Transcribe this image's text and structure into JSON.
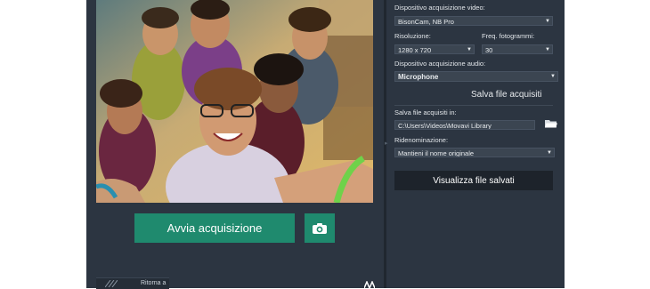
{
  "preview": {
    "image": "group-selfie-photo"
  },
  "capture": {
    "start_label": "Avvia acquisizione",
    "snapshot_icon": "camera-icon"
  },
  "bottom": {
    "return_label": "Ritorna a",
    "corner_icon": "movavi-logo-icon"
  },
  "settings": {
    "video_device_label": "Dispositivo acquisizione video:",
    "video_device_value": "BisonCam, NB Pro",
    "resolution_label": "Risoluzione:",
    "resolution_value": "1280 x 720",
    "fps_label": "Freq. fotogrammi:",
    "fps_value": "30",
    "audio_device_label": "Dispositivo acquisizione audio:",
    "audio_device_value": "Microphone",
    "save_section_title": "Salva file acquisiti",
    "save_in_label": "Salva file acquisiti in:",
    "save_in_value": "C:\\Users\\Videos\\Movavi Library",
    "rename_label": "Ridenominazione:",
    "rename_value": "Mantieni il nome originale",
    "view_files_label": "Visualizza file salvati",
    "dropdown_arrow": "▼"
  },
  "colors": {
    "panel_bg": "#2c3541",
    "accent_green": "#1f8a6e",
    "field_bg": "#3b4551",
    "dark_button": "#1d232b"
  }
}
